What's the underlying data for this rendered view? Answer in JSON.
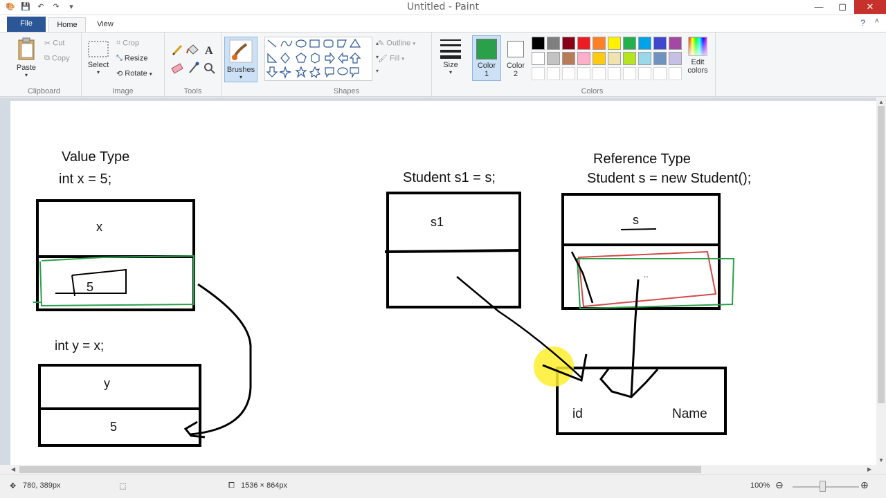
{
  "window": {
    "title": "Untitled - Paint",
    "controls": {
      "minimize": "—",
      "maximize": "▢",
      "close": "✕"
    }
  },
  "tabs": {
    "file": "File",
    "home": "Home",
    "view": "View"
  },
  "ribbon": {
    "clipboard": {
      "label": "Clipboard",
      "paste": "Paste",
      "cut": "Cut",
      "copy": "Copy"
    },
    "image": {
      "label": "Image",
      "select": "Select",
      "crop": "Crop",
      "resize": "Resize",
      "rotate": "Rotate"
    },
    "tools": {
      "label": "Tools"
    },
    "brushes": {
      "label": "Brushes"
    },
    "shapes": {
      "label": "Shapes",
      "outline": "Outline",
      "fill": "Fill"
    },
    "size": {
      "label": "Size"
    },
    "colors": {
      "label": "Colors",
      "color1": "Color",
      "color1_num": "1",
      "color2": "Color",
      "color2_num": "2",
      "edit": "Edit",
      "edit2": "colors",
      "color1_value": "#2aa04a",
      "color2_value": "#ffffff",
      "palette_row1": [
        "#000000",
        "#7f7f7f",
        "#880015",
        "#ed1c24",
        "#ff7f27",
        "#fff200",
        "#22b14c",
        "#00a2e8",
        "#3f48cc",
        "#a349a4"
      ],
      "palette_row2": [
        "#ffffff",
        "#c3c3c3",
        "#b97a57",
        "#ffaec9",
        "#ffc90e",
        "#efe4b0",
        "#b5e61d",
        "#99d9ea",
        "#7092be",
        "#c8bfe7"
      ]
    }
  },
  "canvas": {
    "value_type_title": "Value Type",
    "value_type_code": "int x = 5;",
    "x_label": "x",
    "x_value": "5",
    "int_y_code": "int y = x;",
    "y_label": "y",
    "y_value": "5",
    "s1_code": "Student s1 = s;",
    "s1_label": "s1",
    "reference_type_title": "Reference Type",
    "reference_type_code": "Student s = new Student();",
    "s_label": "s",
    "s_dots": "..",
    "id_label": "id",
    "name_label": "Name"
  },
  "status": {
    "cursor_pos": "780, 389px",
    "canvas_size": "1536 × 864px",
    "zoom": "100%"
  }
}
